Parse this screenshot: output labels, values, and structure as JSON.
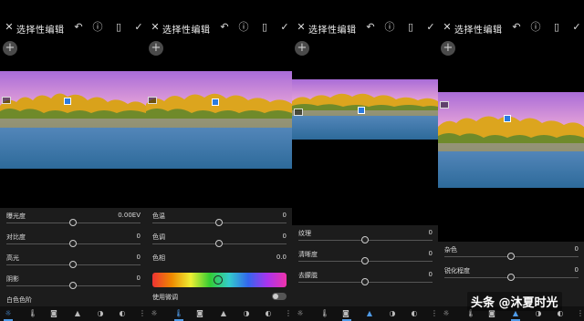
{
  "panels": [
    {
      "title": "选择性编辑",
      "sliders": [
        {
          "label": "曝光度",
          "value": "0.00EV",
          "pos": 0.5
        },
        {
          "label": "对比度",
          "value": "0",
          "pos": 0.5
        },
        {
          "label": "高光",
          "value": "0",
          "pos": 0.5
        },
        {
          "label": "阴影",
          "value": "0",
          "pos": 0.5
        },
        {
          "label": "白色色阶",
          "value": "",
          "pos": 0.5
        }
      ],
      "active_tool": 0
    },
    {
      "title": "选择性编辑",
      "sliders": [
        {
          "label": "色温",
          "value": "0",
          "pos": 0.5
        },
        {
          "label": "色调",
          "value": "0",
          "pos": 0.5
        }
      ],
      "hue_label": "色相",
      "hue_value": "0.0",
      "fine_tune_label": "使用微调",
      "active_tool": 1
    },
    {
      "title": "选择性编辑",
      "sliders": [
        {
          "label": "纹理",
          "value": "0",
          "pos": 0.5
        },
        {
          "label": "清晰度",
          "value": "0",
          "pos": 0.5
        },
        {
          "label": "去朦胧",
          "value": "0",
          "pos": 0.5
        }
      ],
      "active_tool": 3
    },
    {
      "title": "选择性编辑",
      "sliders": [
        {
          "label": "杂色",
          "value": "0",
          "pos": 0.5
        },
        {
          "label": "锐化程度",
          "value": "0",
          "pos": 0.5
        }
      ],
      "active_tool": 4
    }
  ],
  "icons": {
    "close": "✕",
    "undo": "↶",
    "info": "ⓘ",
    "compare": "▯",
    "check": "✓",
    "add": "+",
    "tools": [
      "☼",
      "🌡",
      "◙",
      "▲",
      "◑",
      "◐",
      "⋮"
    ]
  },
  "watermark": "头条 @沐夏时光",
  "colors": {
    "accent": "#4f9be8",
    "sky_top": "#a96cd8",
    "sky_bottom": "#e6a3d8",
    "foliage": "#d9a21b",
    "water": "#3d7aa8"
  }
}
